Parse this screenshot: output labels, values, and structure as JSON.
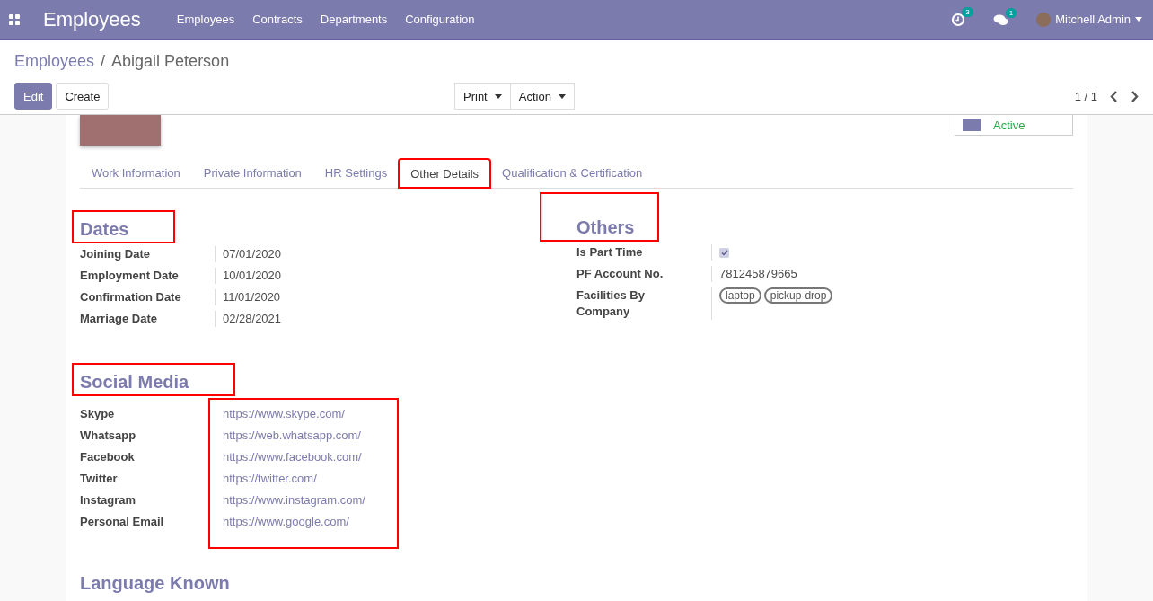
{
  "app_title": "Employees",
  "menu": [
    {
      "label": "Employees"
    },
    {
      "label": "Contracts"
    },
    {
      "label": "Departments"
    },
    {
      "label": "Configuration"
    }
  ],
  "systray": {
    "activity_count": "3",
    "message_count": "1",
    "user": "Mitchell Admin"
  },
  "breadcrumb": {
    "parent": "Employees",
    "separator": "/",
    "current": "Abigail Peterson"
  },
  "buttons": {
    "edit": "Edit",
    "create": "Create",
    "print": "Print",
    "action": "Action"
  },
  "pager": "1 / 1",
  "status_button": "Active",
  "tabs": [
    {
      "label": "Work Information",
      "selected": false,
      "highlighted": false
    },
    {
      "label": "Private Information",
      "selected": false,
      "highlighted": false
    },
    {
      "label": "HR Settings",
      "selected": false,
      "highlighted": false
    },
    {
      "label": "Other Details",
      "selected": true,
      "highlighted": true
    },
    {
      "label": "Qualification & Certification",
      "selected": false,
      "highlighted": false
    }
  ],
  "dates": {
    "title": "Dates",
    "highlighted": true,
    "fields": [
      {
        "label": "Joining Date",
        "value": "07/01/2020"
      },
      {
        "label": "Employment Date",
        "value": "10/01/2020"
      },
      {
        "label": "Confirmation Date",
        "value": "11/01/2020"
      },
      {
        "label": "Marriage Date",
        "value": "02/28/2021"
      }
    ]
  },
  "others": {
    "title": "Others",
    "highlighted": true,
    "fields": [
      {
        "label": "Is Part Time",
        "kind": "checkbox",
        "checked": true
      },
      {
        "label": "PF Account No.",
        "kind": "text",
        "value": "781245879665"
      },
      {
        "label": "Facilities By Company",
        "kind": "tags",
        "tags": [
          "laptop",
          "pickup-drop"
        ]
      }
    ]
  },
  "social_media": {
    "title": "Social Media",
    "highlighted": true,
    "values_highlighted": true,
    "fields": [
      {
        "label": "Skype",
        "value": "https://www.skype.com/"
      },
      {
        "label": "Whatsapp",
        "value": "https://web.whatsapp.com/"
      },
      {
        "label": "Facebook",
        "value": "https://www.facebook.com/"
      },
      {
        "label": "Twitter",
        "value": "https://twitter.com/"
      },
      {
        "label": "Instagram",
        "value": "https://www.instagram.com/"
      },
      {
        "label": "Personal Email",
        "value": "https://www.google.com/"
      }
    ]
  },
  "language_title": "Language Known"
}
